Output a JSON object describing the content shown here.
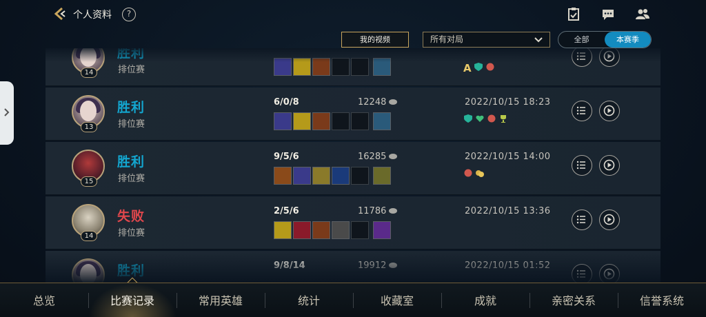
{
  "header": {
    "title": "个人资料",
    "help": "?"
  },
  "filters": {
    "my_video": "我的视频",
    "match_select": "所有对局",
    "season_all": "全部",
    "season_current": "本赛季"
  },
  "matches": [
    {
      "result": "胜利",
      "outcome": "win",
      "mode": "排位赛",
      "level": "14",
      "kda": "",
      "gold": "",
      "date": "",
      "badges": [
        "A",
        "shield-badge",
        "flower-badge"
      ]
    },
    {
      "result": "胜利",
      "outcome": "win",
      "mode": "排位赛",
      "level": "13",
      "kda": "6/0/8",
      "gold": "12248",
      "date": "2022/10/15 18:23",
      "badges": [
        "shield-badge",
        "heart-badge",
        "flower-badge",
        "trophy-badge"
      ]
    },
    {
      "result": "胜利",
      "outcome": "win",
      "mode": "排位赛",
      "level": "15",
      "kda": "9/5/6",
      "gold": "16285",
      "date": "2022/10/15 14:00",
      "badges": [
        "flower-badge",
        "coin-badge"
      ]
    },
    {
      "result": "失败",
      "outcome": "lose",
      "mode": "排位赛",
      "level": "14",
      "kda": "2/5/6",
      "gold": "11786",
      "date": "2022/10/15 13:36",
      "badges": []
    },
    {
      "result": "胜利",
      "outcome": "win",
      "mode": "",
      "level": "",
      "kda": "9/8/14",
      "gold": "19912",
      "date": "2022/10/15 01:52",
      "badges": []
    }
  ],
  "nav": {
    "overview": "总览",
    "match_history": "比赛记录",
    "common_heroes": "常用英雄",
    "stats": "统计",
    "collection": "收藏室",
    "achievements": "成就",
    "intimacy": "亲密关系",
    "honor": "信誉系统"
  },
  "colors": {
    "win": "#13a6cf",
    "lose": "#e0474c",
    "gold_accent": "#c9a55c",
    "season_active": "#138bbf"
  }
}
